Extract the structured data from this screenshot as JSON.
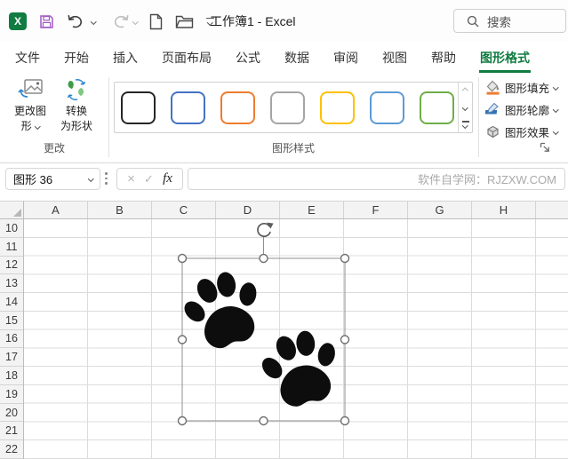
{
  "title_bar": {
    "workbook_title": "工作簿1 - Excel",
    "search_placeholder": "搜索"
  },
  "quick_access": {
    "icons": [
      "excel-logo",
      "save",
      "undo",
      "redo",
      "new-file",
      "open-folder",
      "customize-toolbar"
    ]
  },
  "ribbon_tabs": [
    {
      "label": "文件"
    },
    {
      "label": "开始"
    },
    {
      "label": "插入"
    },
    {
      "label": "页面布局"
    },
    {
      "label": "公式"
    },
    {
      "label": "数据"
    },
    {
      "label": "审阅"
    },
    {
      "label": "视图"
    },
    {
      "label": "帮助"
    },
    {
      "label": "图形格式",
      "active": true
    }
  ],
  "ribbon": {
    "change_group": {
      "label": "更改",
      "change_shape_lines": [
        "更改图",
        "形"
      ],
      "convert_shape_lines": [
        "转换",
        "为形状"
      ]
    },
    "style_gallery": {
      "label": "图形样式",
      "swatch_colors": [
        "#262626",
        "#4472C4",
        "#ED7D31",
        "#A5A5A5",
        "#FFC000",
        "#5B9BD5",
        "#70AD47"
      ]
    },
    "format_buttons": {
      "fill": "图形填充",
      "outline": "图形轮廓",
      "effects": "图形效果"
    }
  },
  "formula_bar": {
    "name_box_value": "图形 36",
    "cancel": "×",
    "enter": "✓",
    "insert_function": "fx",
    "watermark": "软件自学网：RJZXW.COM"
  },
  "grid": {
    "column_headers": [
      "A",
      "B",
      "C",
      "D",
      "E",
      "F",
      "G",
      "H"
    ],
    "row_headers": [
      "10",
      "11",
      "12",
      "13",
      "14",
      "15",
      "16",
      "17",
      "18",
      "19",
      "20",
      "21",
      "22"
    ]
  },
  "shape": {
    "paw_prints": 2
  },
  "colors": {
    "accent_green": "#107C41",
    "fill_icon_bar": "#ED7D31",
    "outline_icon_bar": "#2E75B6"
  }
}
